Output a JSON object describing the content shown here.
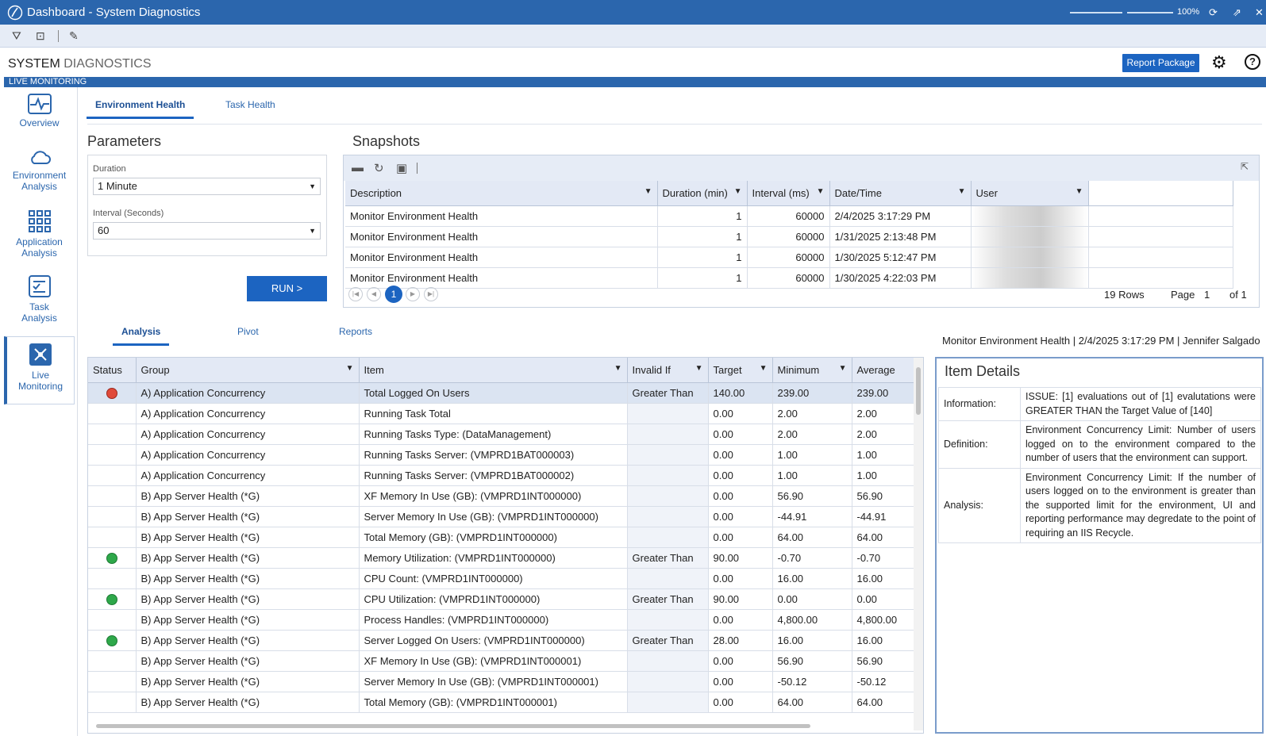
{
  "window": {
    "title": "Dashboard - System Diagnostics",
    "zoom": "100%"
  },
  "app": {
    "title_a": "SYSTEM",
    "title_b": "DIAGNOSTICS",
    "report_label": "Report Package",
    "subbar": "LIVE MONITORING"
  },
  "nav": [
    {
      "l1": "Overview",
      "l2": ""
    },
    {
      "l1": "Environment",
      "l2": "Analysis"
    },
    {
      "l1": "Application",
      "l2": "Analysis"
    },
    {
      "l1": "Task",
      "l2": "Analysis"
    },
    {
      "l1": "Live",
      "l2": "Monitoring"
    }
  ],
  "tabs_top": [
    "Environment Health",
    "Task Health"
  ],
  "params": {
    "title": "Parameters",
    "duration_label": "Duration",
    "duration_value": "1 Minute",
    "interval_label": "Interval (Seconds)",
    "interval_value": "60",
    "run_label": "RUN >"
  },
  "snapshots": {
    "title": "Snapshots",
    "columns": [
      "Description",
      "Duration (min)",
      "Interval (ms)",
      "Date/Time",
      "User"
    ],
    "rows": [
      [
        "Monitor Environment Health",
        "1",
        "60000",
        "2/4/2025 3:17:29 PM"
      ],
      [
        "Monitor Environment Health",
        "1",
        "60000",
        "1/31/2025 2:13:48 PM"
      ],
      [
        "Monitor Environment Health",
        "1",
        "60000",
        "1/30/2025 5:12:47 PM"
      ],
      [
        "Monitor Environment Health",
        "1",
        "60000",
        "1/30/2025 4:22:03 PM"
      ]
    ],
    "page_current": "1",
    "rows_text": "19 Rows",
    "page_label": "Page",
    "page_num": "1",
    "page_of": "of 1"
  },
  "tabs_mid": [
    "Analysis",
    "Pivot",
    "Reports"
  ],
  "context_line": "Monitor Environment Health | 2/4/2025 3:17:29 PM | Jennifer Salgado",
  "analysis": {
    "columns": [
      "Status",
      "Group",
      "Item",
      "Invalid If",
      "Target",
      "Minimum",
      "Average"
    ],
    "rows": [
      {
        "status": "red",
        "group": "A) Application Concurrency",
        "item": "Total Logged On Users",
        "invalid": "Greater Than",
        "target": "140.00",
        "min": "239.00",
        "avg": "239.00"
      },
      {
        "status": "",
        "group": "A) Application Concurrency",
        "item": "Running Task Total",
        "invalid": "",
        "target": "0.00",
        "min": "2.00",
        "avg": "2.00"
      },
      {
        "status": "",
        "group": "A) Application Concurrency",
        "item": "Running Tasks Type: (DataManagement)",
        "invalid": "",
        "target": "0.00",
        "min": "2.00",
        "avg": "2.00"
      },
      {
        "status": "",
        "group": "A) Application Concurrency",
        "item": "Running Tasks Server: (VMPRD1BAT000003)",
        "invalid": "",
        "target": "0.00",
        "min": "1.00",
        "avg": "1.00"
      },
      {
        "status": "",
        "group": "A) Application Concurrency",
        "item": "Running Tasks Server: (VMPRD1BAT000002)",
        "invalid": "",
        "target": "0.00",
        "min": "1.00",
        "avg": "1.00"
      },
      {
        "status": "",
        "group": "B) App Server Health (*G)",
        "item": "XF Memory In Use (GB): (VMPRD1INT000000)",
        "invalid": "",
        "target": "0.00",
        "min": "56.90",
        "avg": "56.90"
      },
      {
        "status": "",
        "group": "B) App Server Health (*G)",
        "item": "Server Memory In Use (GB): (VMPRD1INT000000)",
        "invalid": "",
        "target": "0.00",
        "min": "-44.91",
        "avg": "-44.91"
      },
      {
        "status": "",
        "group": "B) App Server Health (*G)",
        "item": "Total Memory (GB): (VMPRD1INT000000)",
        "invalid": "",
        "target": "0.00",
        "min": "64.00",
        "avg": "64.00"
      },
      {
        "status": "green",
        "group": "B) App Server Health (*G)",
        "item": "Memory Utilization: (VMPRD1INT000000)",
        "invalid": "Greater Than",
        "target": "90.00",
        "min": "-0.70",
        "avg": "-0.70"
      },
      {
        "status": "",
        "group": "B) App Server Health (*G)",
        "item": "CPU Count: (VMPRD1INT000000)",
        "invalid": "",
        "target": "0.00",
        "min": "16.00",
        "avg": "16.00"
      },
      {
        "status": "green",
        "group": "B) App Server Health (*G)",
        "item": "CPU Utilization: (VMPRD1INT000000)",
        "invalid": "Greater Than",
        "target": "90.00",
        "min": "0.00",
        "avg": "0.00"
      },
      {
        "status": "",
        "group": "B) App Server Health (*G)",
        "item": "Process Handles: (VMPRD1INT000000)",
        "invalid": "",
        "target": "0.00",
        "min": "4,800.00",
        "avg": "4,800.00"
      },
      {
        "status": "green",
        "group": "B) App Server Health (*G)",
        "item": "Server Logged On Users: (VMPRD1INT000000)",
        "invalid": "Greater Than",
        "target": "28.00",
        "min": "16.00",
        "avg": "16.00"
      },
      {
        "status": "",
        "group": "B) App Server Health (*G)",
        "item": "XF Memory In Use (GB): (VMPRD1INT000001)",
        "invalid": "",
        "target": "0.00",
        "min": "56.90",
        "avg": "56.90"
      },
      {
        "status": "",
        "group": "B) App Server Health (*G)",
        "item": "Server Memory In Use (GB): (VMPRD1INT000001)",
        "invalid": "",
        "target": "0.00",
        "min": "-50.12",
        "avg": "-50.12"
      },
      {
        "status": "",
        "group": "B) App Server Health (*G)",
        "item": "Total Memory (GB): (VMPRD1INT000001)",
        "invalid": "",
        "target": "0.00",
        "min": "64.00",
        "avg": "64.00"
      }
    ]
  },
  "details": {
    "title": "Item Details",
    "rows": [
      {
        "k": "Information:",
        "v": "ISSUE: [1] evaluations out of [1] evalutations were GREATER THAN the Target Value of [140]"
      },
      {
        "k": "Definition:",
        "v": "Environment Concurrency Limit:  Number of users logged on to the environment compared to the number of users that the environment can support."
      },
      {
        "k": "Analysis:",
        "v": "Environment Concurrency Limit:  If the number of users logged on to the environment is greater than the supported limit for the environment, UI and reporting performance may degredate to the point of requiring an IIS Recycle."
      }
    ]
  },
  "colors": {
    "accent": "#2b66ad",
    "button": "#1c64c1",
    "status_red": "#e04a3a",
    "status_green": "#2ea84a"
  }
}
